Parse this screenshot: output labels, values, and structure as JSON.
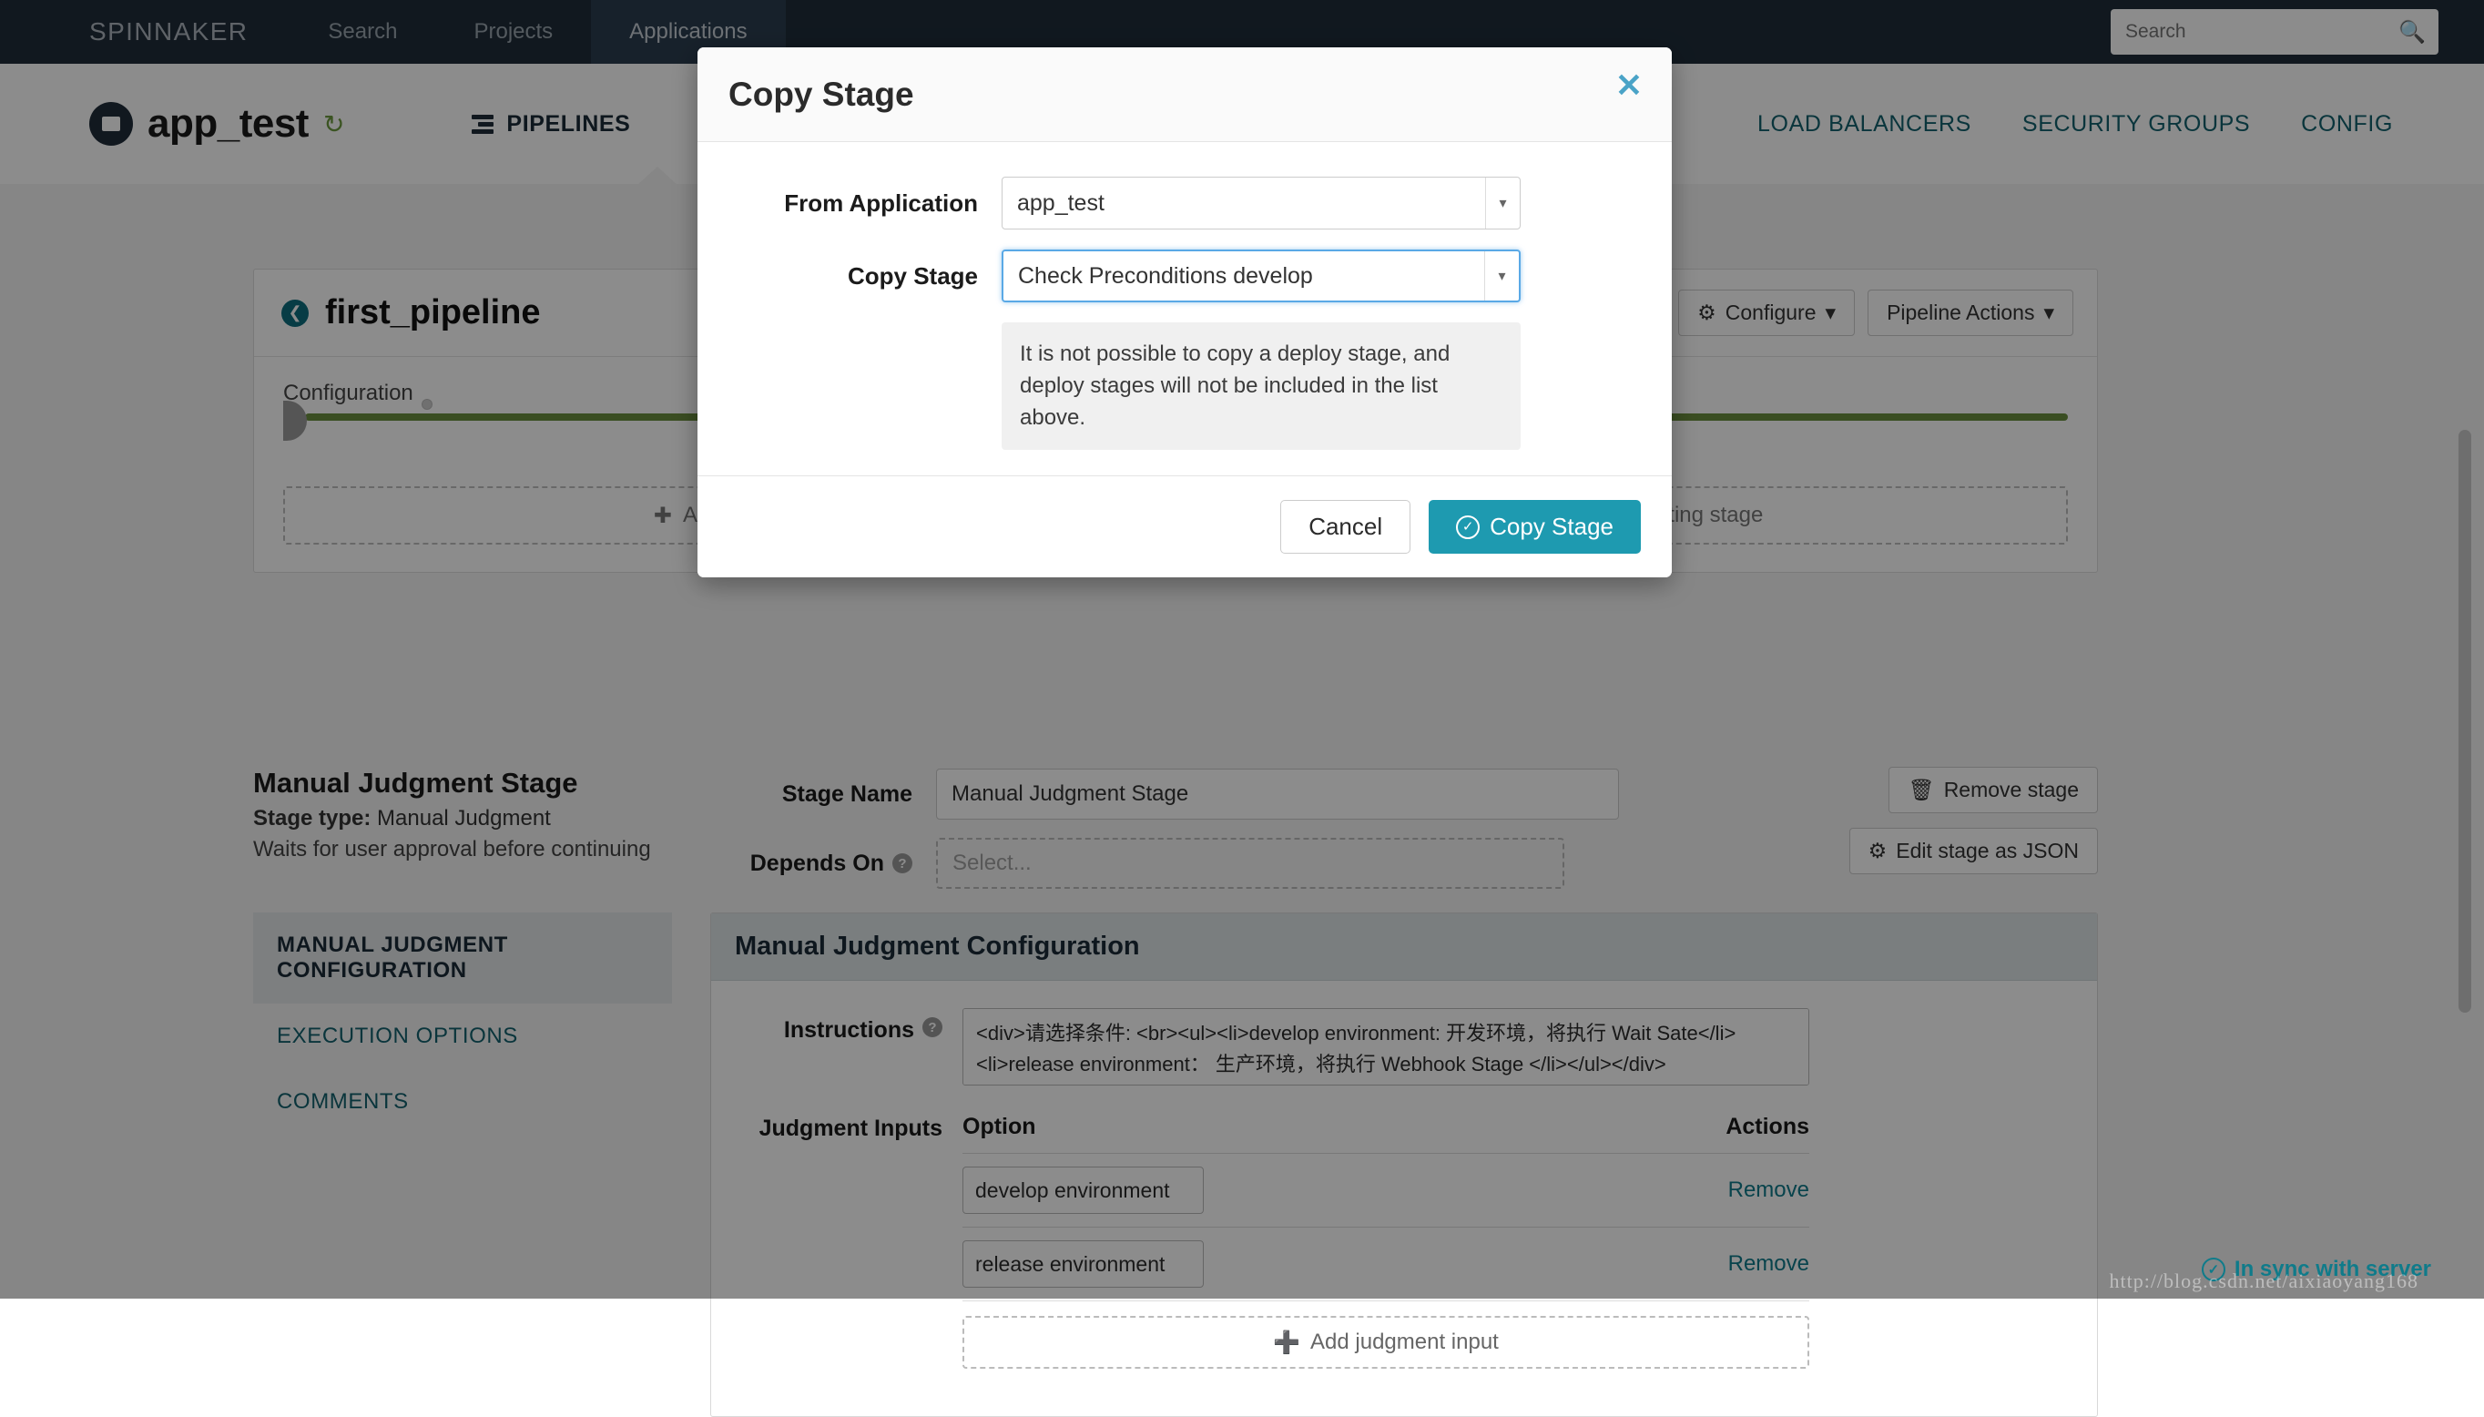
{
  "topnav": {
    "brand": "SPINNAKER",
    "links": [
      {
        "label": "Search",
        "active": false
      },
      {
        "label": "Projects",
        "active": false
      },
      {
        "label": "Applications",
        "active": true
      }
    ],
    "search_placeholder": "Search",
    "search_value": "",
    "search_icon": "search-icon"
  },
  "appheader": {
    "app_name": "app_test",
    "refresh_icon": "refresh-icon",
    "tabs_left": [
      {
        "label": "PIPELINES",
        "active": true
      }
    ],
    "tabs_right": [
      {
        "label": "LOAD BALANCERS"
      },
      {
        "label": "SECURITY GROUPS"
      },
      {
        "label": "CONFIG"
      }
    ]
  },
  "pipeline": {
    "name": "first_pipeline",
    "back_icon": "back-arrow-icon",
    "buttons": [
      {
        "label": "Configure",
        "icon": "gear-icon",
        "caret": true
      },
      {
        "label": "Pipeline Actions",
        "icon": "",
        "caret": true
      }
    ],
    "graph": {
      "nodes": [
        {
          "label": "Configuration"
        },
        {
          "label": "Check Preconditions develop"
        }
      ]
    },
    "add_boxes": [
      {
        "label": "Add stage",
        "icon": "plus-icon"
      },
      {
        "label": "Copy an existing stage",
        "icon": "copy-icon"
      }
    ]
  },
  "stage": {
    "title": "Manual Judgment Stage",
    "type_label": "Stage type:",
    "type_value": "Manual Judgment",
    "description": "Waits for user approval before continuing",
    "fields": [
      {
        "label": "Stage Name",
        "value": "Manual Judgment Stage",
        "help": false
      },
      {
        "label": "Depends On",
        "value": "",
        "placeholder": "Select...",
        "help": true
      }
    ],
    "actions": [
      {
        "label": "Remove stage",
        "icon": "trash-icon"
      },
      {
        "label": "Edit stage as JSON",
        "icon": "gear-icon"
      }
    ]
  },
  "config": {
    "side_tabs": [
      {
        "label": "MANUAL JUDGMENT CONFIGURATION",
        "active": true
      },
      {
        "label": "EXECUTION OPTIONS",
        "active": false
      },
      {
        "label": "COMMENTS",
        "active": false
      }
    ],
    "panel_title": "Manual Judgment Configuration",
    "instructions_label": "Instructions",
    "instructions_value": "<div>请选择条件: <br><ul><li>develop environment: 开发环境，将执行 Wait Sate</li><li>release environment： 生产环境，将执行 Webhook Stage </li></ul></div>",
    "judgment_inputs_label": "Judgment Inputs",
    "table_headers": {
      "option": "Option",
      "actions": "Actions"
    },
    "rows": [
      {
        "option": "develop environment",
        "action": "Remove"
      },
      {
        "option": "release environment",
        "action": "Remove"
      }
    ],
    "add_label": "Add judgment input",
    "add_icon": "plus-circle-icon"
  },
  "footer": {
    "sync_status": "In sync with server",
    "sync_icon": "check-circle-icon",
    "watermark": "http://blog.csdn.net/aixiaoyang168"
  },
  "modal": {
    "title": "Copy Stage",
    "close_icon": "close-icon",
    "fields": [
      {
        "label": "From Application",
        "value": "app_test",
        "focused": false
      },
      {
        "label": "Copy Stage",
        "value": "Check Preconditions develop",
        "focused": true
      }
    ],
    "note": "It is not possible to copy a deploy stage, and deploy stages will not be included in the list above.",
    "cancel_label": "Cancel",
    "submit_label": "Copy Stage",
    "submit_icon": "check-circle-icon",
    "accent_color": "#1e9ab0"
  }
}
